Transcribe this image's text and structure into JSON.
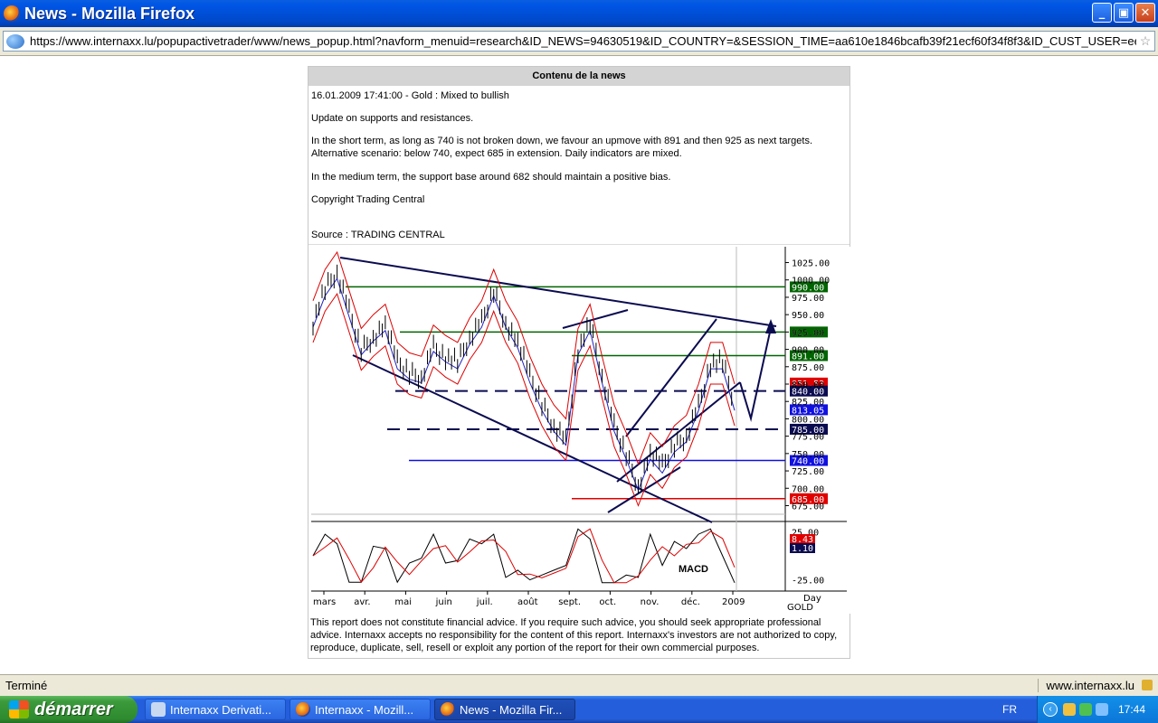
{
  "window": {
    "title": "News - Mozilla Firefox",
    "buttons": {
      "minimize": "_",
      "maximize": "▣",
      "close": "✕"
    }
  },
  "address_bar": {
    "url": "https://www.internaxx.lu/popupactivetrader/www/news_popup.html?navform_menuid=research&ID_NEWS=94630519&ID_COUNTRY=&SESSION_TIME=aa610e1846bcafb39f21ecf60f34f8f3&ID_CUST_USER=eef("
  },
  "panel": {
    "header": "Contenu de la news",
    "dateline": "16.01.2009 17:41:00 - Gold : Mixed to bullish",
    "p1": "Update on supports and resistances.",
    "p2a": "In the short term, as long as 740 is not broken down, we favour an upmove with 891 and then 925 as next targets.",
    "p2b": "Alternative scenario: below 740, expect 685 in extension. Daily indicators are mixed.",
    "p3": "In the medium term, the support base around 682 should maintain a positive bias.",
    "copyright": "Copyright Trading Central",
    "source": "Source : TRADING CENTRAL",
    "disclaimer": "This report does not constitute financial advice. If you require such advice, you should seek appropriate professional advice. Internaxx accepts no responsibility for the content of this report. Internaxx's investors are not authorized to copy, reproduce, duplicate, sell, resell or exploit any portion of the report for their own commercial purposes."
  },
  "chart_data": {
    "type": "line",
    "instrument": "GOLD",
    "timeframe": "Day",
    "indicator": "MACD",
    "ylim": [
      660,
      1040
    ],
    "y_ticks": [
      675,
      700,
      725,
      750,
      775,
      800,
      825,
      850,
      875,
      900,
      925,
      950,
      975,
      1000,
      1025
    ],
    "x_ticks": [
      "mars",
      "avr.",
      "mai",
      "juin",
      "juil.",
      "août",
      "sept.",
      "oct.",
      "nov.",
      "déc.",
      "2009"
    ],
    "levels": [
      {
        "value": 990.0,
        "label": "990.00",
        "color": "#006400",
        "style": "solid"
      },
      {
        "value": 925.0,
        "label": "925.00",
        "color": "#006400",
        "style": "solid"
      },
      {
        "value": 891.0,
        "label": "891.00",
        "color": "#006400",
        "style": "solid"
      },
      {
        "value": 851.53,
        "label": "851.53",
        "color": "#e00000",
        "style": "tag"
      },
      {
        "value": 840.0,
        "label": "840.00",
        "color": "#0b0b50",
        "style": "dashed"
      },
      {
        "value": 813.05,
        "label": "813.05",
        "color": "#1010e0",
        "style": "tag"
      },
      {
        "value": 785.0,
        "label": "785.00",
        "color": "#0b0b50",
        "style": "dashed"
      },
      {
        "value": 740.0,
        "label": "740.00",
        "color": "#1010e0",
        "style": "solid"
      },
      {
        "value": 685.0,
        "label": "685.00",
        "color": "#e00000",
        "style": "solid"
      }
    ],
    "price_x": [
      0,
      3,
      6,
      9,
      12,
      15,
      18,
      21,
      24,
      27,
      30,
      33,
      36,
      39,
      42,
      45,
      48,
      51,
      54,
      57,
      60,
      63,
      66,
      69,
      72,
      75,
      78,
      81,
      84,
      87,
      90,
      93,
      96,
      99,
      102,
      105
    ],
    "price": [
      940,
      985,
      1010,
      955,
      900,
      920,
      935,
      880,
      865,
      860,
      905,
      890,
      880,
      915,
      940,
      985,
      940,
      910,
      860,
      820,
      790,
      770,
      900,
      935,
      860,
      790,
      750,
      705,
      750,
      730,
      760,
      775,
      820,
      880,
      880,
      820
    ],
    "macd": {
      "ylim": [
        -32,
        32
      ],
      "y_ticks": [
        25,
        -25
      ],
      "tags": [
        "8.43",
        "1.10"
      ]
    }
  },
  "status_bar": {
    "left": "Terminé",
    "right": "www.internaxx.lu"
  },
  "taskbar": {
    "start": "démarrer",
    "tasks": [
      "Internaxx Derivati...",
      "Internaxx - Mozill...",
      "News - Mozilla Fir..."
    ],
    "lang": "FR",
    "clock": "17:44"
  }
}
